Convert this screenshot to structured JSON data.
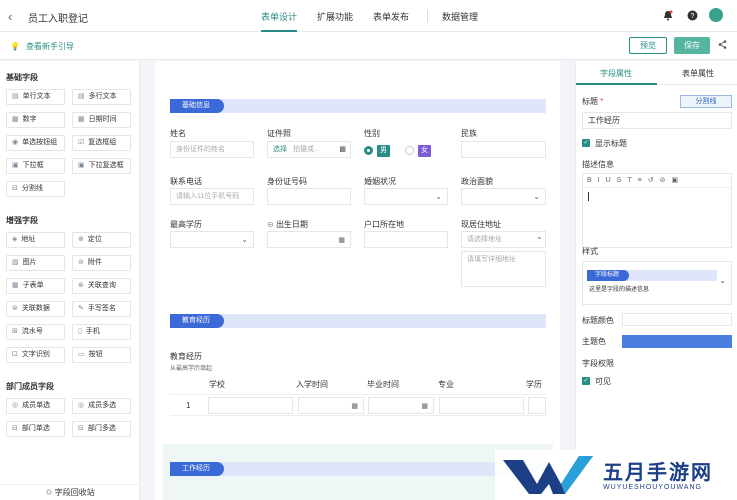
{
  "header": {
    "back_icon": "chevron-left-icon",
    "title": "员工入职登记",
    "tabs": [
      {
        "label": "表单设计",
        "active": true
      },
      {
        "label": "扩展功能",
        "active": false
      },
      {
        "label": "表单发布",
        "active": false
      },
      {
        "label": "数据管理",
        "active": false
      }
    ],
    "icons": [
      "bell-icon",
      "help-icon",
      "avatar"
    ]
  },
  "subbar": {
    "guide_label": "查看新手引导",
    "preview_label": "预览",
    "save_label": "保存",
    "share_icon": "share-icon"
  },
  "left": {
    "basic_title": "基础字段",
    "basic_fields": [
      "单行文本",
      "多行文本",
      "数字",
      "日期时间",
      "单选按钮组",
      "复选框组",
      "下拉框",
      "下拉复选框",
      "分割线"
    ],
    "enhanced_title": "增强字段",
    "enhanced_fields": [
      "地址",
      "定位",
      "图片",
      "附件",
      "子表单",
      "关联查询",
      "关联数据",
      "手写签名",
      "流水号",
      "手机",
      "文字识别",
      "按钮"
    ],
    "dept_title": "部门成员字段",
    "dept_fields": [
      "成员单选",
      "成员多选",
      "部门单选",
      "部门多选"
    ],
    "recycle_label": "字段回收站"
  },
  "form": {
    "section1": "基础信息",
    "name_label": "姓名",
    "name_placeholder": "身份证件的姓名",
    "id_photo_label": "证件照",
    "upload_select": "选择",
    "upload_hint": "拍摄或...",
    "gender_label": "性别",
    "gender_male": "男",
    "gender_female": "女",
    "ethnic_label": "民族",
    "phone_label": "联系电话",
    "phone_placeholder": "请输入11位手机号码",
    "idcard_label": "身份证号码",
    "marital_label": "婚姻状况",
    "political_label": "政治面貌",
    "education_label": "最高学历",
    "birthday_label": "出生日期",
    "hukou_label": "户口所在地",
    "address_label": "现居住地址",
    "address_select_placeholder": "请选择地址",
    "address_detail_placeholder": "请填写详细地址",
    "section2": "教育经历",
    "edu_table_title": "教育经历",
    "edu_table_subtitle": "从最高学历填起",
    "edu_columns": [
      "学校",
      "入学时间",
      "毕业时间",
      "专业",
      "学历"
    ],
    "edu_row_index": "1",
    "section3": "工作经历"
  },
  "right": {
    "tabs": [
      {
        "label": "字段属性",
        "active": true
      },
      {
        "label": "表单属性",
        "active": false
      }
    ],
    "title_label": "标题",
    "required_mark": "*",
    "divider_button": "分割线",
    "title_value": "工作经历",
    "show_title_label": "显示标题",
    "desc_label": "描述信息",
    "editor_tools": [
      "B",
      "I",
      "U",
      "S",
      "T",
      "≡",
      "↺",
      "⊘",
      "▣"
    ],
    "style_label": "样式",
    "style_tag": "字段标题",
    "style_sub": "这里是字段的描述信息",
    "title_color_label": "标题颜色",
    "theme_color_label": "主题色",
    "theme_color": "#4a7de0",
    "permission_label": "字段权限",
    "visible_label": "可见"
  },
  "watermark": {
    "title": "五月手游网",
    "subtitle": "WUYUESHOUYOUWANG"
  },
  "colors": {
    "accent": "#2a8c86",
    "section_blue": "#3c69d8",
    "section_bg": "#dfe6fa"
  }
}
